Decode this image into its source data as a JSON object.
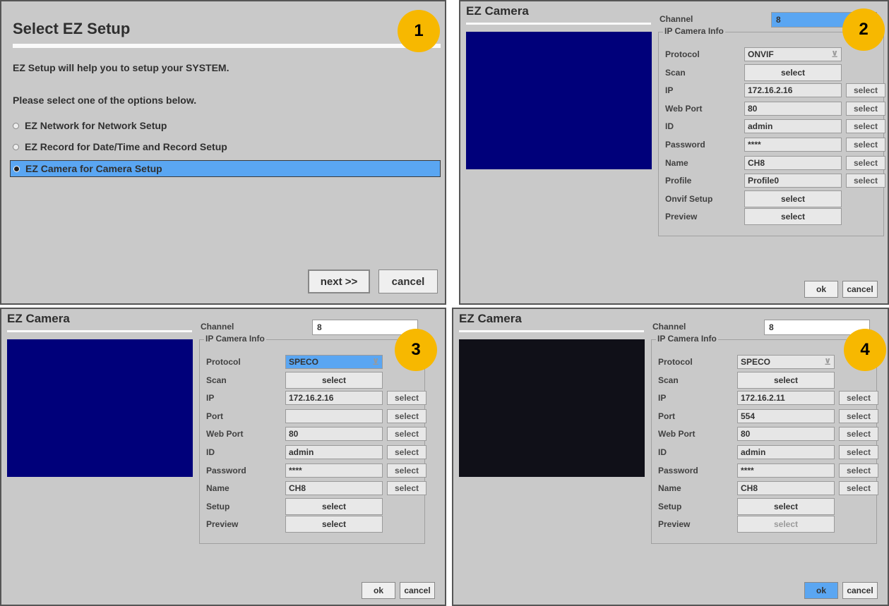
{
  "panel1": {
    "badge": "1",
    "title": "Select EZ Setup",
    "desc": "EZ Setup will help you to setup your SYSTEM.",
    "prompt": "Please select one of the options below.",
    "options": [
      "EZ Network for Network Setup",
      "EZ Record for Date/Time and Record Setup",
      "EZ Camera for Camera Setup"
    ],
    "selected_index": 2,
    "next_label": "next >>",
    "cancel_label": "cancel"
  },
  "panel2": {
    "badge": "2",
    "title": "EZ Camera",
    "channel_label": "Channel",
    "channel_value": "8",
    "group_label": "IP Camera Info",
    "protocol_label": "Protocol",
    "protocol_value": "ONVIF",
    "rows": [
      {
        "label": "Scan",
        "value": null,
        "wide": "select"
      },
      {
        "label": "IP",
        "value": "172.16.2.16",
        "btn": "select"
      },
      {
        "label": "Web Port",
        "value": "80",
        "btn": "select"
      },
      {
        "label": "ID",
        "value": "admin",
        "btn": "select"
      },
      {
        "label": "Password",
        "value": "****",
        "btn": "select"
      },
      {
        "label": "Name",
        "value": "CH8",
        "btn": "select"
      },
      {
        "label": "Profile",
        "value": "Profile0",
        "btn": "select"
      },
      {
        "label": "Onvif Setup",
        "value": null,
        "wide": "select"
      },
      {
        "label": "Preview",
        "value": null,
        "wide": "select"
      }
    ],
    "ok_label": "ok",
    "cancel_label": "cancel",
    "preview_color": "#00007a"
  },
  "panel3": {
    "badge": "3",
    "title": "EZ Camera",
    "channel_label": "Channel",
    "channel_value": "8",
    "group_label": "IP Camera Info",
    "protocol_label": "Protocol",
    "protocol_value": "SPECO",
    "rows": [
      {
        "label": "Scan",
        "value": null,
        "wide": "select"
      },
      {
        "label": "IP",
        "value": "172.16.2.16",
        "btn": "select"
      },
      {
        "label": "Port",
        "value": "",
        "btn": "select"
      },
      {
        "label": "Web Port",
        "value": "80",
        "btn": "select"
      },
      {
        "label": "ID",
        "value": "admin",
        "btn": "select"
      },
      {
        "label": "Password",
        "value": "****",
        "btn": "select"
      },
      {
        "label": "Name",
        "value": "CH8",
        "btn": "select"
      },
      {
        "label": "Setup",
        "value": null,
        "wide": "select"
      },
      {
        "label": "Preview",
        "value": null,
        "wide": "select"
      }
    ],
    "ok_label": "ok",
    "cancel_label": "cancel",
    "preview_color": "#00007a"
  },
  "panel4": {
    "badge": "4",
    "title": "EZ Camera",
    "channel_label": "Channel",
    "channel_value": "8",
    "group_label": "IP Camera Info",
    "protocol_label": "Protocol",
    "protocol_value": "SPECO",
    "rows": [
      {
        "label": "Scan",
        "value": null,
        "wide": "select"
      },
      {
        "label": "IP",
        "value": "172.16.2.11",
        "btn": "select"
      },
      {
        "label": "Port",
        "value": "554",
        "btn": "select"
      },
      {
        "label": "Web Port",
        "value": "80",
        "btn": "select"
      },
      {
        "label": "ID",
        "value": "admin",
        "btn": "select"
      },
      {
        "label": "Password",
        "value": "****",
        "btn": "select"
      },
      {
        "label": "Name",
        "value": "CH8",
        "btn": "select"
      },
      {
        "label": "Setup",
        "value": null,
        "wide": "select"
      },
      {
        "label": "Preview",
        "value": null,
        "wide": "select",
        "dim": true
      }
    ],
    "ok_label": "ok",
    "cancel_label": "cancel",
    "preview_color": "#101018"
  },
  "colors": {
    "highlight": "#5aa6f2",
    "badge": "#f7b800",
    "panel_bg": "#c9c9c9"
  }
}
